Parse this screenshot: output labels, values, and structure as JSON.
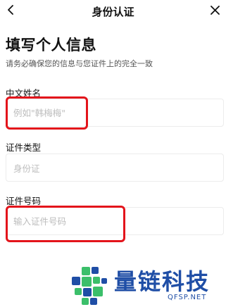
{
  "header": {
    "title": "身份认证",
    "back_icon": "chevron-left-icon",
    "close_icon": "close-icon"
  },
  "page": {
    "title": "填写个人信息",
    "subtitle": "请务必确保您的信息与您证件上的完全一致"
  },
  "form": {
    "name": {
      "label": "中文姓名",
      "placeholder": "例如\"韩梅梅\"",
      "value": ""
    },
    "id_type": {
      "label": "证件类型",
      "value": "身份证"
    },
    "id_number": {
      "label": "证件号码",
      "placeholder": "输入证件号码",
      "value": ""
    }
  },
  "highlight_color": "#e3141b",
  "watermark": {
    "name": "量链科技",
    "domain": "QFSP.NET",
    "color": "#1f4ea6",
    "accent_color": "#3bbf6a"
  }
}
